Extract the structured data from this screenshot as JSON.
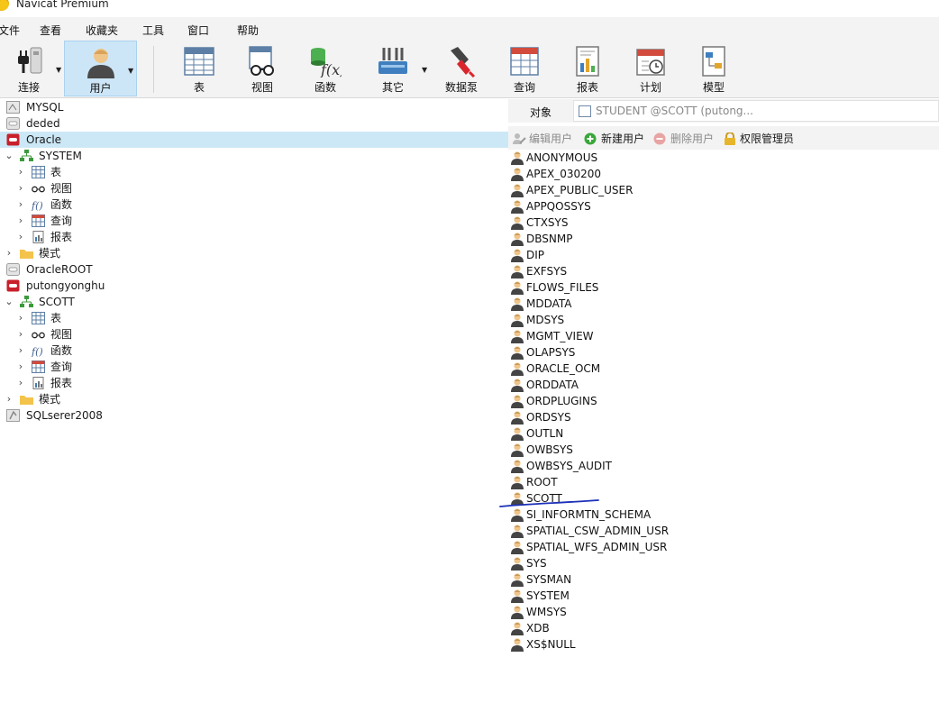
{
  "window": {
    "title": "Navicat Premium"
  },
  "menu": [
    "文件",
    "查看",
    "收藏夹",
    "工具",
    "窗口",
    "帮助"
  ],
  "toolbar": {
    "items": [
      {
        "label": "连接",
        "icon": "plug-icon"
      },
      {
        "label": "用户",
        "icon": "user-icon",
        "active": true
      },
      {
        "label": "表",
        "icon": "table-icon"
      },
      {
        "label": "视图",
        "icon": "view-glasses-icon"
      },
      {
        "label": "函数",
        "icon": "function-icon"
      },
      {
        "label": "其它",
        "icon": "tools-icon"
      },
      {
        "label": "数据泵",
        "icon": "data-pump-icon"
      },
      {
        "label": "查询",
        "icon": "query-icon"
      },
      {
        "label": "报表",
        "icon": "report-icon"
      },
      {
        "label": "计划",
        "icon": "calendar-icon"
      },
      {
        "label": "模型",
        "icon": "model-icon"
      }
    ]
  },
  "tree": [
    {
      "label": "MYSQL",
      "icon": "connection-mysql-icon",
      "depth": 0
    },
    {
      "label": "deded",
      "icon": "connection-grey-icon",
      "depth": 0
    },
    {
      "label": "Oracle",
      "icon": "connection-oracle-icon",
      "depth": 0,
      "selected": true
    },
    {
      "label": "SYSTEM",
      "icon": "schema-icon",
      "depth": 0,
      "expanded": true
    },
    {
      "label": "表",
      "icon": "table-icon",
      "depth": 1
    },
    {
      "label": "视图",
      "icon": "view-glasses-icon",
      "depth": 1
    },
    {
      "label": "函数",
      "icon": "function-icon",
      "depth": 1
    },
    {
      "label": "查询",
      "icon": "query-icon",
      "depth": 1
    },
    {
      "label": "报表",
      "icon": "report-icon",
      "depth": 1
    },
    {
      "label": "模式",
      "icon": "folder-icon",
      "depth": 0,
      "collapsed": true
    },
    {
      "label": "OracleROOT",
      "icon": "connection-grey-icon",
      "depth": 0
    },
    {
      "label": "putongyonghu",
      "icon": "connection-oracle-icon",
      "depth": 0
    },
    {
      "label": "SCOTT",
      "icon": "schema-icon",
      "depth": 0,
      "expanded": true
    },
    {
      "label": "表",
      "icon": "table-icon",
      "depth": 1
    },
    {
      "label": "视图",
      "icon": "view-glasses-icon",
      "depth": 1
    },
    {
      "label": "函数",
      "icon": "function-icon",
      "depth": 1
    },
    {
      "label": "查询",
      "icon": "query-icon",
      "depth": 1
    },
    {
      "label": "报表",
      "icon": "report-icon",
      "depth": 1
    },
    {
      "label": "模式",
      "icon": "folder-icon",
      "depth": 0,
      "collapsed": true
    },
    {
      "label": "SQLserer2008",
      "icon": "connection-sqlserver-icon",
      "depth": 0
    }
  ],
  "objects": {
    "label": "对象",
    "tab": "STUDENT @SCOTT (putong..."
  },
  "obj_toolbar": {
    "edit": "编辑用户",
    "new": "新建用户",
    "delete": "删除用户",
    "privilege": "权限管理员"
  },
  "users": [
    "ANONYMOUS",
    "APEX_030200",
    "APEX_PUBLIC_USER",
    "APPQOSSYS",
    "CTXSYS",
    "DBSNMP",
    "DIP",
    "EXFSYS",
    "FLOWS_FILES",
    "MDDATA",
    "MDSYS",
    "MGMT_VIEW",
    "OLAPSYS",
    "ORACLE_OCM",
    "ORDDATA",
    "ORDPLUGINS",
    "ORDSYS",
    "OUTLN",
    "OWBSYS",
    "OWBSYS_AUDIT",
    "ROOT",
    "SCOTT",
    "SI_INFORMTN_SCHEMA",
    "SPATIAL_CSW_ADMIN_USR",
    "SPATIAL_WFS_ADMIN_USR",
    "SYS",
    "SYSMAN",
    "SYSTEM",
    "WMSYS",
    "XDB",
    "XS$NULL"
  ],
  "colors": {
    "selection": "#cce8f6",
    "toolbar_active": "#cde6f7",
    "annotation_ink": "#1b2fb8",
    "oracle_red": "#c8202a"
  }
}
